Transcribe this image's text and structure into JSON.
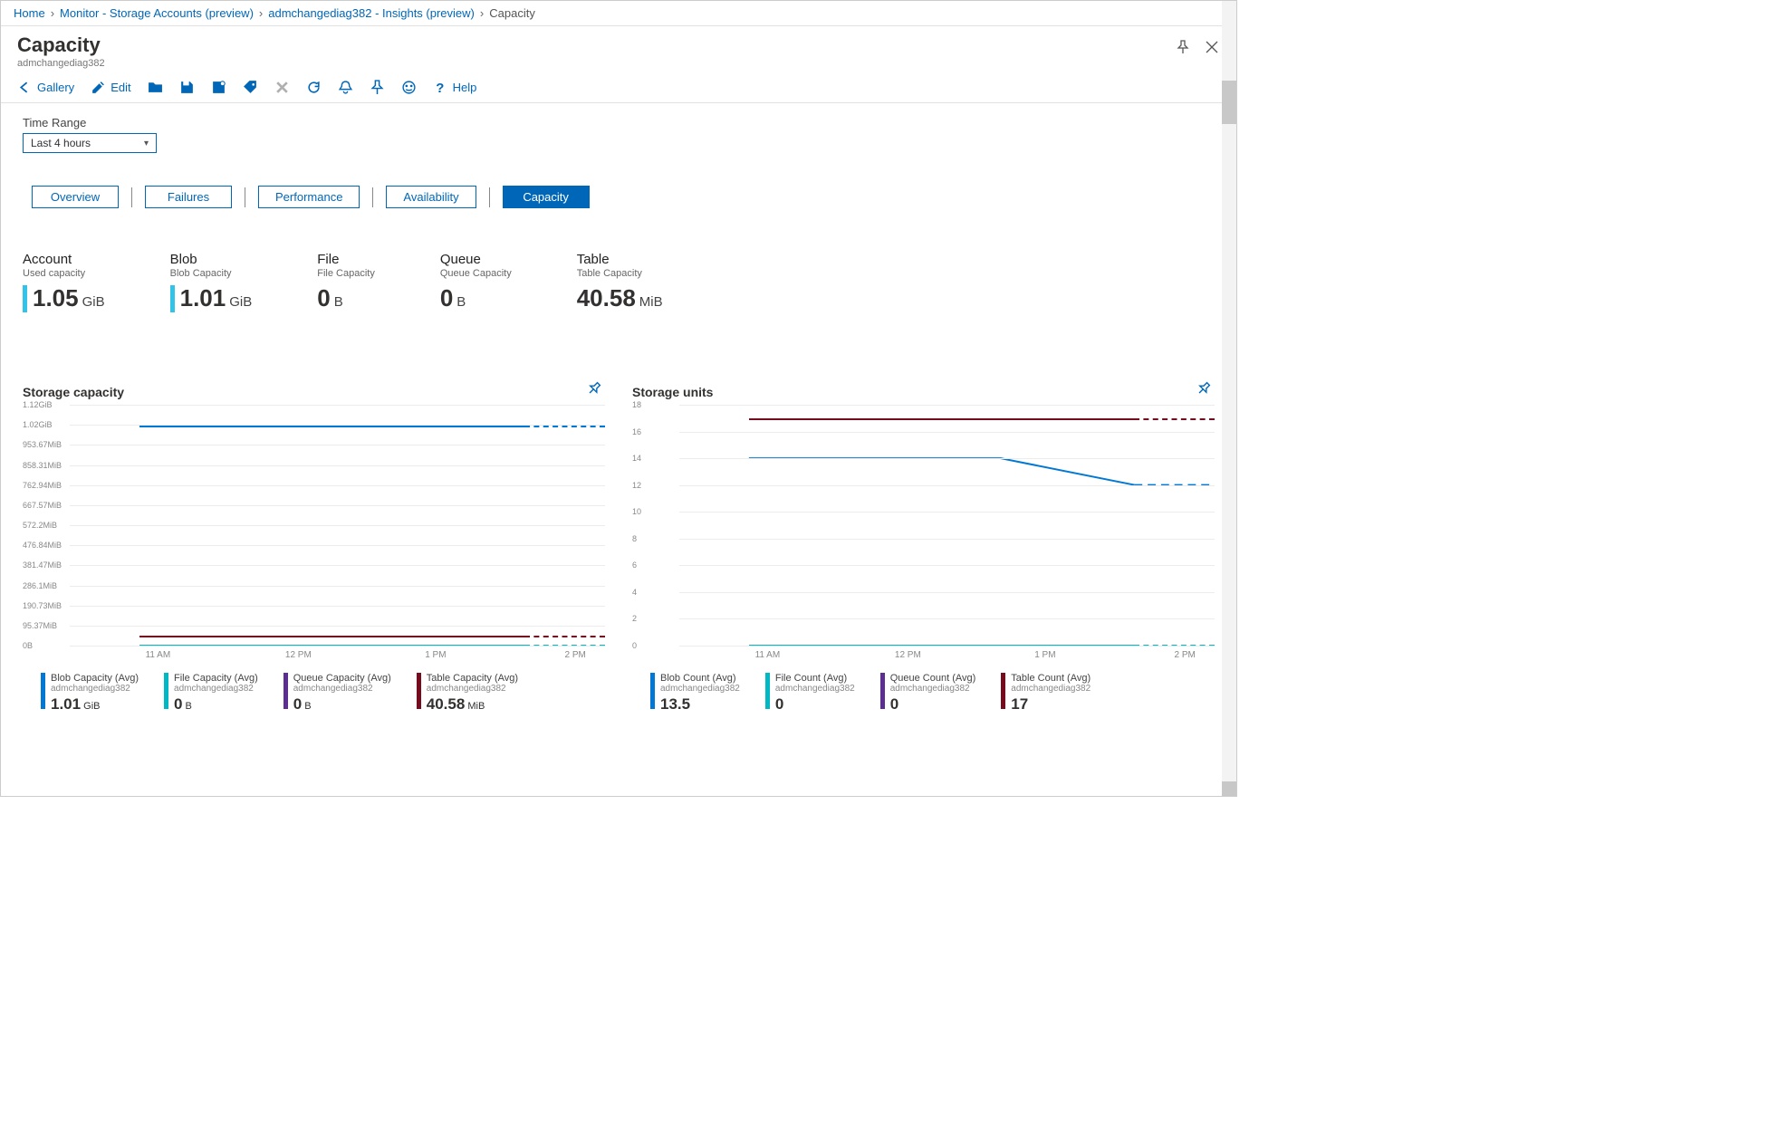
{
  "breadcrumb": {
    "home": "Home",
    "monitor": "Monitor - Storage Accounts (preview)",
    "resource": "admchangediag382 - Insights (preview)",
    "current": "Capacity"
  },
  "header": {
    "title": "Capacity",
    "subtitle": "admchangediag382"
  },
  "toolbar": {
    "gallery": "Gallery",
    "edit": "Edit",
    "help": "Help"
  },
  "timeRange": {
    "label": "Time Range",
    "value": "Last 4 hours"
  },
  "tabs": {
    "overview": "Overview",
    "failures": "Failures",
    "performance": "Performance",
    "availability": "Availability",
    "capacity": "Capacity"
  },
  "metrics": [
    {
      "title": "Account",
      "sub": "Used capacity",
      "value": "1.05",
      "unit": "GiB",
      "bar": true
    },
    {
      "title": "Blob",
      "sub": "Blob Capacity",
      "value": "1.01",
      "unit": "GiB",
      "bar": true
    },
    {
      "title": "File",
      "sub": "File Capacity",
      "value": "0",
      "unit": "B",
      "bar": false
    },
    {
      "title": "Queue",
      "sub": "Queue Capacity",
      "value": "0",
      "unit": "B",
      "bar": false
    },
    {
      "title": "Table",
      "sub": "Table Capacity",
      "value": "40.58",
      "unit": "MiB",
      "bar": false
    }
  ],
  "chart1": {
    "title": "Storage capacity",
    "yticks": [
      "1.12GiB",
      "1.02GiB",
      "953.67MiB",
      "858.31MiB",
      "762.94MiB",
      "667.57MiB",
      "572.2MiB",
      "476.84MiB",
      "381.47MiB",
      "286.1MiB",
      "190.73MiB",
      "95.37MiB",
      "0B"
    ],
    "xticks": [
      "11 AM",
      "12 PM",
      "1 PM",
      "2 PM"
    ],
    "legend": [
      {
        "title": "Blob Capacity (Avg)",
        "sub": "admchangediag382",
        "value": "1.01",
        "unit": "GiB",
        "color": "#0078d4"
      },
      {
        "title": "File Capacity (Avg)",
        "sub": "admchangediag382",
        "value": "0",
        "unit": "B",
        "color": "#00b7c3"
      },
      {
        "title": "Queue Capacity (Avg)",
        "sub": "admchangediag382",
        "value": "0",
        "unit": "B",
        "color": "#5c2e91"
      },
      {
        "title": "Table Capacity (Avg)",
        "sub": "admchangediag382",
        "value": "40.58",
        "unit": "MiB",
        "color": "#750b1c"
      }
    ]
  },
  "chart2": {
    "title": "Storage units",
    "yticks": [
      "18",
      "16",
      "14",
      "12",
      "10",
      "8",
      "6",
      "4",
      "2",
      "0"
    ],
    "xticks": [
      "11 AM",
      "12 PM",
      "1 PM",
      "2 PM"
    ],
    "legend": [
      {
        "title": "Blob Count (Avg)",
        "sub": "admchangediag382",
        "value": "13.5",
        "unit": "",
        "color": "#0078d4"
      },
      {
        "title": "File Count (Avg)",
        "sub": "admchangediag382",
        "value": "0",
        "unit": "",
        "color": "#00b7c3"
      },
      {
        "title": "Queue Count (Avg)",
        "sub": "admchangediag382",
        "value": "0",
        "unit": "",
        "color": "#5c2e91"
      },
      {
        "title": "Table Count (Avg)",
        "sub": "admchangediag382",
        "value": "17",
        "unit": "",
        "color": "#750b1c"
      }
    ]
  },
  "chart_data": [
    {
      "type": "line",
      "title": "Storage capacity",
      "x": [
        "11 AM",
        "12 PM",
        "1 PM",
        "2 PM"
      ],
      "series": [
        {
          "name": "Blob Capacity (Avg)",
          "unit": "GiB",
          "values": [
            1.01,
            1.01,
            1.01,
            1.01
          ]
        },
        {
          "name": "File Capacity (Avg)",
          "unit": "B",
          "values": [
            0,
            0,
            0,
            0
          ]
        },
        {
          "name": "Queue Capacity (Avg)",
          "unit": "B",
          "values": [
            0,
            0,
            0,
            0
          ]
        },
        {
          "name": "Table Capacity (Avg)",
          "unit": "MiB",
          "values": [
            40.58,
            40.58,
            40.58,
            40.58
          ]
        }
      ],
      "ylim_label": [
        "0B",
        "1.12GiB"
      ]
    },
    {
      "type": "line",
      "title": "Storage units",
      "x": [
        "11 AM",
        "12 PM",
        "1 PM",
        "2 PM"
      ],
      "series": [
        {
          "name": "Blob Count (Avg)",
          "values": [
            14,
            14,
            14,
            12
          ]
        },
        {
          "name": "File Count (Avg)",
          "values": [
            0,
            0,
            0,
            0
          ]
        },
        {
          "name": "Queue Count (Avg)",
          "values": [
            0,
            0,
            0,
            0
          ]
        },
        {
          "name": "Table Count (Avg)",
          "values": [
            17,
            17,
            17,
            17
          ]
        }
      ],
      "ylim": [
        0,
        18
      ]
    }
  ]
}
